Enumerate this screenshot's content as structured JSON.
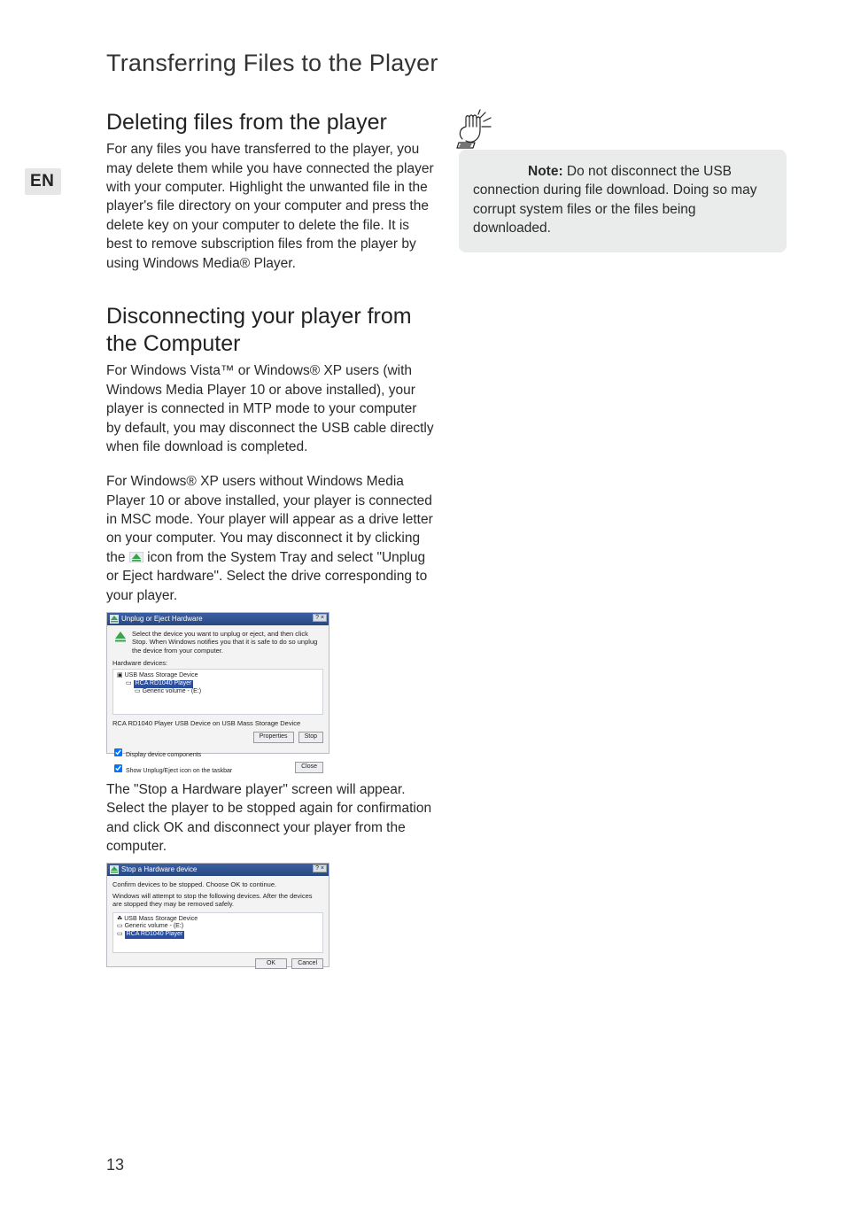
{
  "lang_tab": "EN",
  "page_number": "13",
  "chapter_title": "Transferring Files to the Player",
  "section_deleting": {
    "title": "Deleting files from the player",
    "body": "For any files you have transferred to the player, you may delete them while you have connected the player with your computer. Highlight the unwanted file in the player's file directory on your computer and press the delete key on your computer to delete the file. It is best to remove subscription files from the player by using Windows Media® Player."
  },
  "section_disconnect": {
    "title": "Disconnecting your player from the Computer",
    "p1": "For Windows Vista™ or  Windows® XP  users (with Windows Media Player 10 or above installed), your player is connected in MTP mode to your computer by default, you may disconnect the USB cable directly when file download is completed.",
    "p2_pre": "For Windows® XP users without Windows Media Player 10 or above installed, your player is connected in MSC  mode. Your player will appear as a drive letter on your computer. You may disconnect it by clicking the ",
    "p2_post": " icon from the System Tray and select \"Unplug or Eject hardware\". Select the drive corresponding to your player.",
    "p3": "The \"Stop a Hardware player\" screen will appear. Select the player to be stopped again for confirmation and click OK and disconnect your player from the computer."
  },
  "note": {
    "label": "Note:",
    "text": " Do not disconnect the USB connection during file download. Doing so may corrupt system files or the files being downloaded."
  },
  "dialog1": {
    "title": "Unplug or Eject Hardware",
    "intro": "Select the device you want to unplug or eject, and then click Stop. When Windows notifies you that it is safe to do so unplug the device from your computer.",
    "hw_label": "Hardware devices:",
    "tree_line1": "USB Mass Storage Device",
    "tree_line2": "RCA RD1040 Player",
    "tree_line3": "Generic volume - (E:)",
    "desc": "RCA RD1040 Player USB Device on USB Mass Storage Device",
    "btn_properties": "Properties",
    "btn_stop": "Stop",
    "chk1": "Display device components",
    "chk2": "Show Unplug/Eject icon on the taskbar",
    "btn_close": "Close"
  },
  "dialog2": {
    "title": "Stop a Hardware device",
    "intro1": "Confirm devices to be stopped. Choose OK to continue.",
    "intro2": "Windows will attempt to stop the following devices. After the devices are stopped they may be removed safely.",
    "item1": "USB Mass Storage Device",
    "item2": "Generic volume - (E:)",
    "item3": "RCA RD1040 Player",
    "btn_ok": "OK",
    "btn_cancel": "Cancel"
  }
}
